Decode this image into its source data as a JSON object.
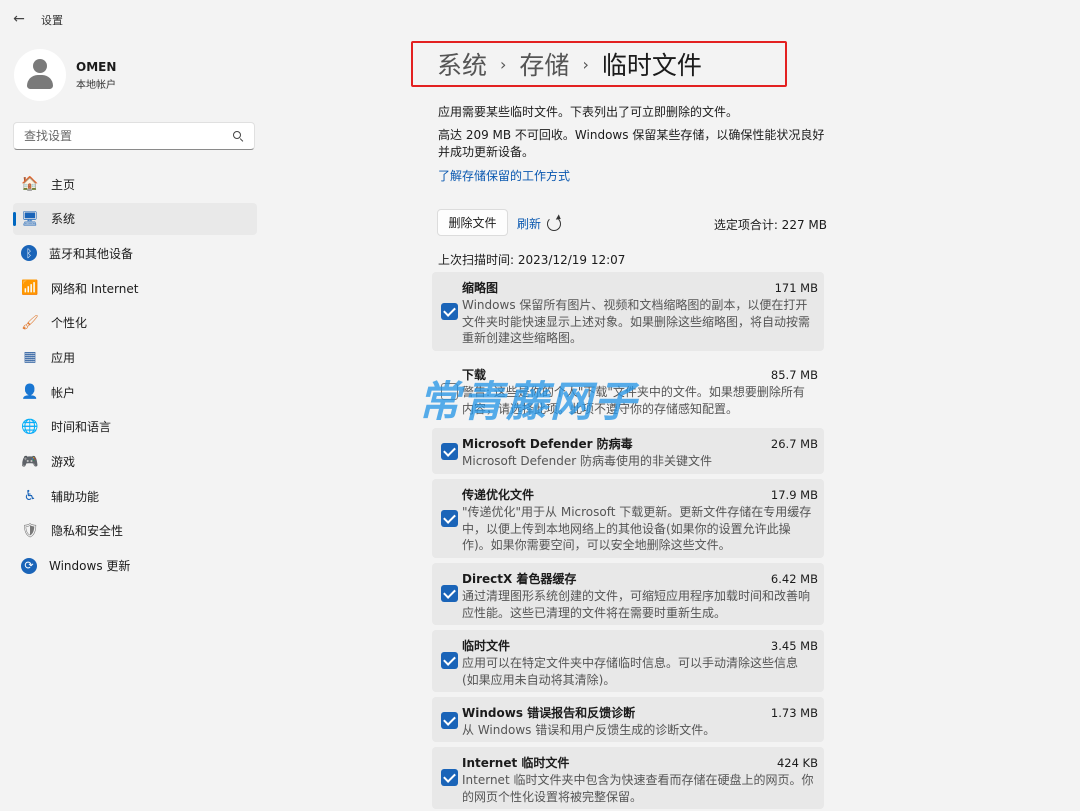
{
  "app": {
    "title": "设置"
  },
  "profile": {
    "name": "OMEN",
    "account_type": "本地帐户"
  },
  "search": {
    "placeholder": "查找设置"
  },
  "sidebar": {
    "items": [
      {
        "label": "主页",
        "icon": "home-icon",
        "glyph": "🏠",
        "active": false
      },
      {
        "label": "系统",
        "icon": "system-icon",
        "glyph": "🖥",
        "active": true
      },
      {
        "label": "蓝牙和其他设备",
        "icon": "bluetooth-icon",
        "glyph": "ᛒ",
        "active": false
      },
      {
        "label": "网络和 Internet",
        "icon": "wifi-icon",
        "glyph": "📶",
        "active": false
      },
      {
        "label": "个性化",
        "icon": "brush-icon",
        "glyph": "🖌",
        "active": false
      },
      {
        "label": "应用",
        "icon": "apps-icon",
        "glyph": "▦",
        "active": false
      },
      {
        "label": "帐户",
        "icon": "account-icon",
        "glyph": "👤",
        "active": false
      },
      {
        "label": "时间和语言",
        "icon": "globe-clock-icon",
        "glyph": "🌐",
        "active": false
      },
      {
        "label": "游戏",
        "icon": "gamepad-icon",
        "glyph": "🎮",
        "active": false
      },
      {
        "label": "辅助功能",
        "icon": "accessibility-icon",
        "glyph": "♿",
        "active": false
      },
      {
        "label": "隐私和安全性",
        "icon": "shield-icon",
        "glyph": "🛡",
        "active": false
      },
      {
        "label": "Windows 更新",
        "icon": "update-icon",
        "glyph": "⟳",
        "active": false
      }
    ]
  },
  "breadcrumb": {
    "level1": "系统",
    "level2": "存储",
    "current": "临时文件",
    "separator": "›"
  },
  "main": {
    "intro": "应用需要某些临时文件。下表列出了可立即删除的文件。",
    "reserved_note": "高达 209 MB 不可回收。Windows 保留某些存储，以确保性能状况良好并成功更新设备。",
    "learn_link": "了解存储保留的工作方式",
    "delete_button": "删除文件",
    "refresh_label": "刷新",
    "selected_total": "选定项合计: 227 MB",
    "last_scan": "上次扫描时间: 2023/12/19 12:07"
  },
  "items": [
    {
      "title": "缩略图",
      "size": "171 MB",
      "checked": true,
      "desc": "Windows 保留所有图片、视频和文档缩略图的副本，以便在打开文件夹时能快速显示上述对象。如果删除这些缩略图，将自动按需重新创建这些缩略图。"
    },
    {
      "title": "下载",
      "size": "85.7 MB",
      "checked": false,
      "desc": "警告: 这些是你的个人\"下载\"文件夹中的文件。如果想要删除所有内容，请选择此项。此项不遵守你的存储感知配置。"
    },
    {
      "title": "Microsoft Defender 防病毒",
      "size": "26.7 MB",
      "checked": true,
      "desc": "Microsoft Defender 防病毒使用的非关键文件"
    },
    {
      "title": "传递优化文件",
      "size": "17.9 MB",
      "checked": true,
      "desc": "\"传递优化\"用于从 Microsoft 下载更新。更新文件存储在专用缓存中，以便上传到本地网络上的其他设备(如果你的设置允许此操作)。如果你需要空间，可以安全地删除这些文件。"
    },
    {
      "title": "DirectX 着色器缓存",
      "size": "6.42 MB",
      "checked": true,
      "desc": "通过清理图形系统创建的文件，可缩短应用程序加载时间和改善响应性能。这些已清理的文件将在需要时重新生成。"
    },
    {
      "title": "临时文件",
      "size": "3.45 MB",
      "checked": true,
      "desc": "应用可以在特定文件夹中存储临时信息。可以手动清除这些信息(如果应用未自动将其清除)。"
    },
    {
      "title": "Windows 错误报告和反馈诊断",
      "size": "1.73 MB",
      "checked": true,
      "desc": "从 Windows 错误和用户反馈生成的诊断文件。"
    },
    {
      "title": "Internet 临时文件",
      "size": "424 KB",
      "checked": true,
      "desc": "Internet 临时文件夹中包含为快速查看而存储在硬盘上的网页。你的网页个性化设置将被完整保留。"
    }
  ],
  "watermark": {
    "text": "常青藤网子"
  },
  "colors": {
    "accent": "#1a64b8",
    "highlight": "#e32020",
    "link": "#0a58b0"
  }
}
